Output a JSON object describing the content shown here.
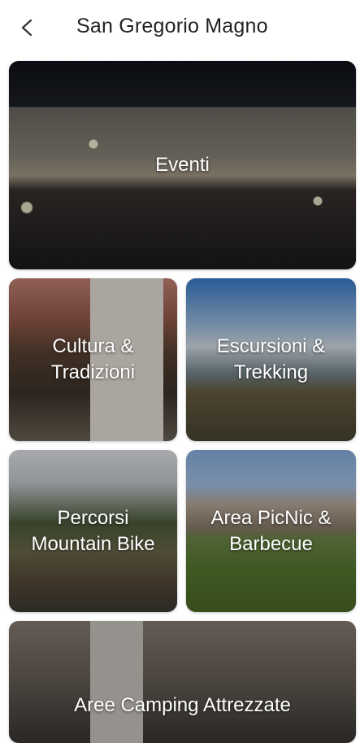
{
  "header": {
    "title": "San Gregorio Magno",
    "back_icon": "back-arrow-icon"
  },
  "tiles": [
    {
      "label": "Eventi"
    },
    {
      "label": "Cultura &\nTradizioni"
    },
    {
      "label": "Escursioni &\nTrekking"
    },
    {
      "label": "Percorsi\nMountain Bike"
    },
    {
      "label": "Area PicNic &\nBarbecue"
    },
    {
      "label": "Aree Camping Attrezzate"
    }
  ]
}
